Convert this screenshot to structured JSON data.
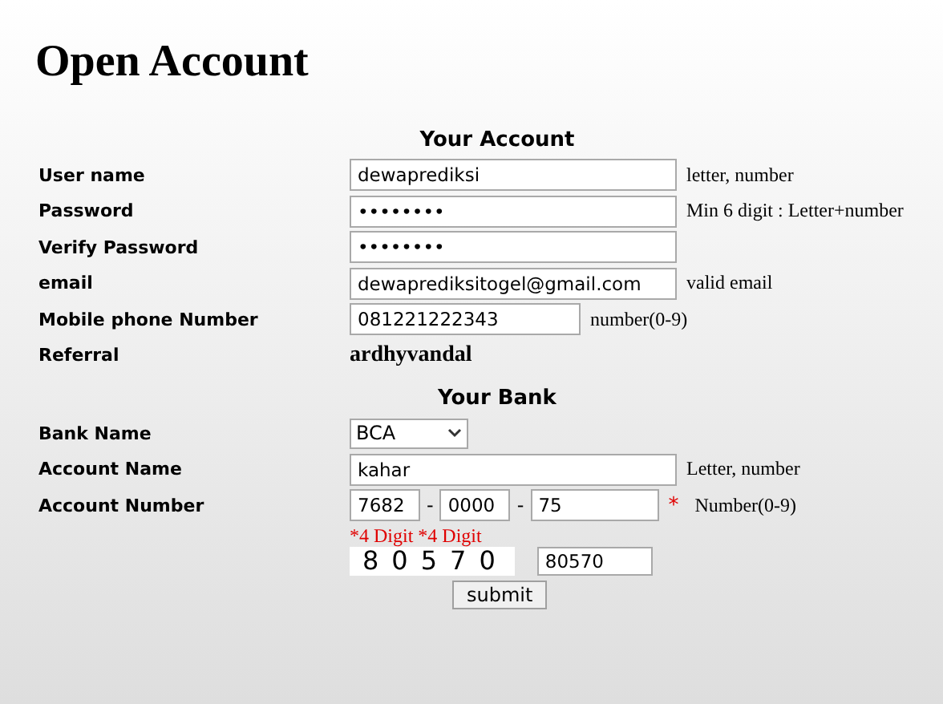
{
  "title": "Open Account",
  "sections": [
    {
      "heading": "Your Account",
      "rows": [
        {
          "kind": "text",
          "label": "User name",
          "value": "dewaprediksi",
          "hint": "letter, number"
        },
        {
          "kind": "text",
          "label": "Password",
          "value": "••••••••",
          "hint": "Min 6 digit : Letter+number"
        },
        {
          "kind": "text",
          "label": "Verify Password",
          "value": "••••••••"
        },
        {
          "kind": "text",
          "label": "email",
          "value": "dewaprediksitogel@gmail.com",
          "hint": "valid email"
        },
        {
          "kind": "short",
          "label": "Mobile phone Number",
          "value": "081221222343",
          "hint": "number(0-9)"
        },
        {
          "kind": "static",
          "label": "Referral",
          "value": "ardhyvandal"
        }
      ]
    },
    {
      "heading": "Your Bank",
      "rows": [
        {
          "kind": "select",
          "label": "Bank Name",
          "value": "BCA"
        },
        {
          "kind": "text",
          "label": "Account Name",
          "value": "kahar",
          "hint": "Letter, number"
        },
        {
          "kind": "split",
          "label": "Account Number",
          "parts": [
            "7682",
            "0000",
            "75"
          ],
          "separator": "-",
          "marker": "*",
          "hint": "Number(0-9)",
          "note": "*4 Digit *4 Digit"
        }
      ]
    }
  ],
  "captcha": {
    "code": "80570",
    "value": "80570"
  },
  "submit": "submit"
}
